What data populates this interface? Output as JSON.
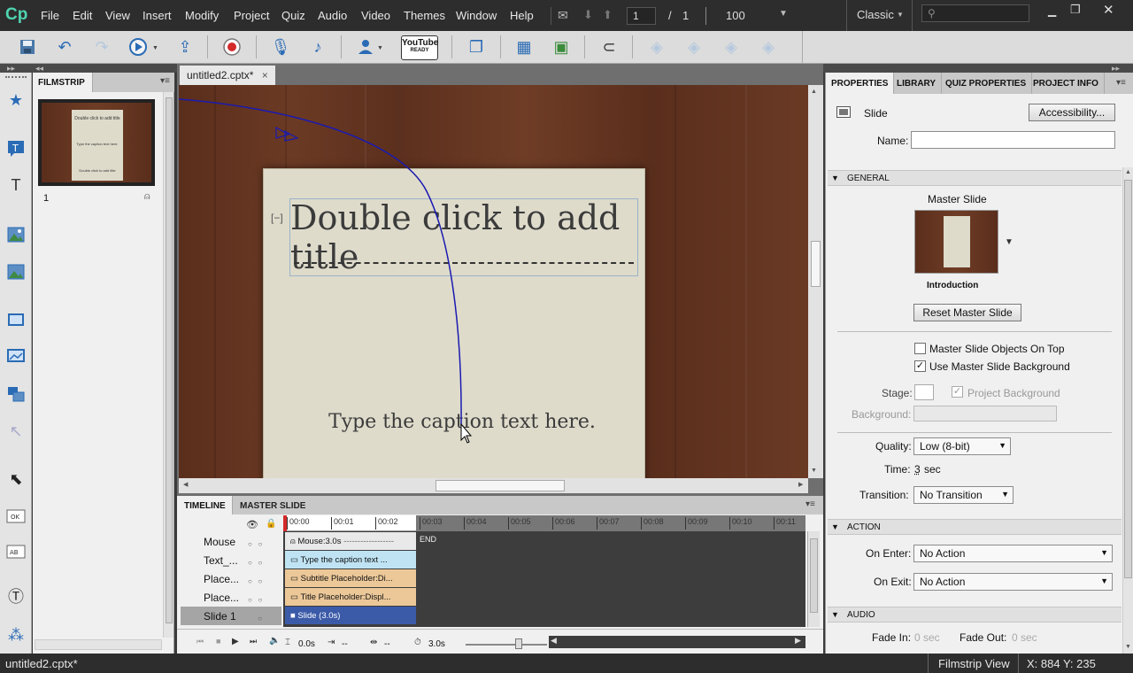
{
  "app": {
    "logo": "Cp"
  },
  "menu": [
    "File",
    "Edit",
    "View",
    "Insert",
    "Modify",
    "Project",
    "Quiz",
    "Audio",
    "Video",
    "Themes",
    "Window",
    "Help"
  ],
  "nav": {
    "current_slide": "1",
    "separator": "/",
    "total_slides": "1",
    "zoom": "100",
    "workspace": "Classic",
    "search_placeholder": ""
  },
  "toolbar_icons": [
    "save-icon",
    "undo-icon",
    "redo-icon",
    "preview-icon",
    "publish-icon",
    "record-icon",
    "microphone-icon",
    "audio-icon",
    "user-icon",
    "youtube-icon",
    "copy-icon",
    "table-icon",
    "grid-icon",
    "magnet-icon",
    "layer-icons"
  ],
  "toolbar": {
    "youtube_label": "YouTube",
    "youtube_sub": "READY"
  },
  "filmstrip": {
    "tab": "FILMSTRIP",
    "thumb_number": "1",
    "thumb_title": "Double click to add title",
    "thumb_caption": "Type the caption text here."
  },
  "document": {
    "tab_title": "untitled2.cptx*",
    "close": "×"
  },
  "slide": {
    "title": "Double click to add title",
    "caption": "Type the caption text here.",
    "collapse_glyph": "[−]"
  },
  "timeline": {
    "tabs": [
      "TIMELINE",
      "MASTER SLIDE"
    ],
    "ticks": [
      "00:00",
      "00:01",
      "00:02",
      "00:03",
      "00:04",
      "00:05",
      "00:06",
      "00:07",
      "00:08",
      "00:09",
      "00:10",
      "00:11"
    ],
    "rows": [
      {
        "label": "Mouse",
        "bar": "Mouse:3.0s"
      },
      {
        "label": "Text_...",
        "bar": "Type the caption text ..."
      },
      {
        "label": "Place...",
        "bar": "Subtitle Placeholder:Di..."
      },
      {
        "label": "Place...",
        "bar": "Title Placeholder:Displ..."
      },
      {
        "label": "Slide 1",
        "bar": "Slide (3.0s)"
      }
    ],
    "end_label": "END",
    "footer": {
      "start": "0.0s",
      "in": "--",
      "out": "--",
      "duration": "3.0s"
    }
  },
  "properties": {
    "tabs": [
      "PROPERTIES",
      "LIBRARY",
      "QUIZ PROPERTIES",
      "PROJECT INFO"
    ],
    "object_type": "Slide",
    "accessibility_button": "Accessibility...",
    "name_label": "Name:",
    "name_value": "",
    "general": {
      "header": "GENERAL",
      "master_slide_label": "Master Slide",
      "master_slide_name": "Introduction",
      "reset_button": "Reset Master Slide",
      "objects_on_top": "Master Slide Objects On Top",
      "objects_on_top_checked": false,
      "use_background": "Use Master Slide Background",
      "use_background_checked": true,
      "stage_label": "Stage:",
      "project_background": "Project Background",
      "background_label": "Background:",
      "quality_label": "Quality:",
      "quality_value": "Low (8-bit)",
      "time_label": "Time:",
      "time_value": "3",
      "time_unit": "sec",
      "transition_label": "Transition:",
      "transition_value": "No Transition"
    },
    "action": {
      "header": "ACTION",
      "on_enter_label": "On Enter:",
      "on_enter_value": "No Action",
      "on_exit_label": "On Exit:",
      "on_exit_value": "No Action"
    },
    "audio": {
      "header": "AUDIO",
      "fade_in_label": "Fade In:",
      "fade_in_value": "0",
      "fade_out_label": "Fade Out:",
      "fade_out_value": "0",
      "unit": "sec"
    }
  },
  "status": {
    "file": "untitled2.cptx*",
    "view": "Filmstrip View",
    "coords": "X: 884 Y: 235"
  },
  "colors": {
    "menubar": "#2d2d2d",
    "accent": "#2a6bb5",
    "mouse_path": "#1a1ab0",
    "slide_bar": "#3b5aa8",
    "caption_bar": "#bfe3f3",
    "placeholder_bar": "#ecc899"
  }
}
